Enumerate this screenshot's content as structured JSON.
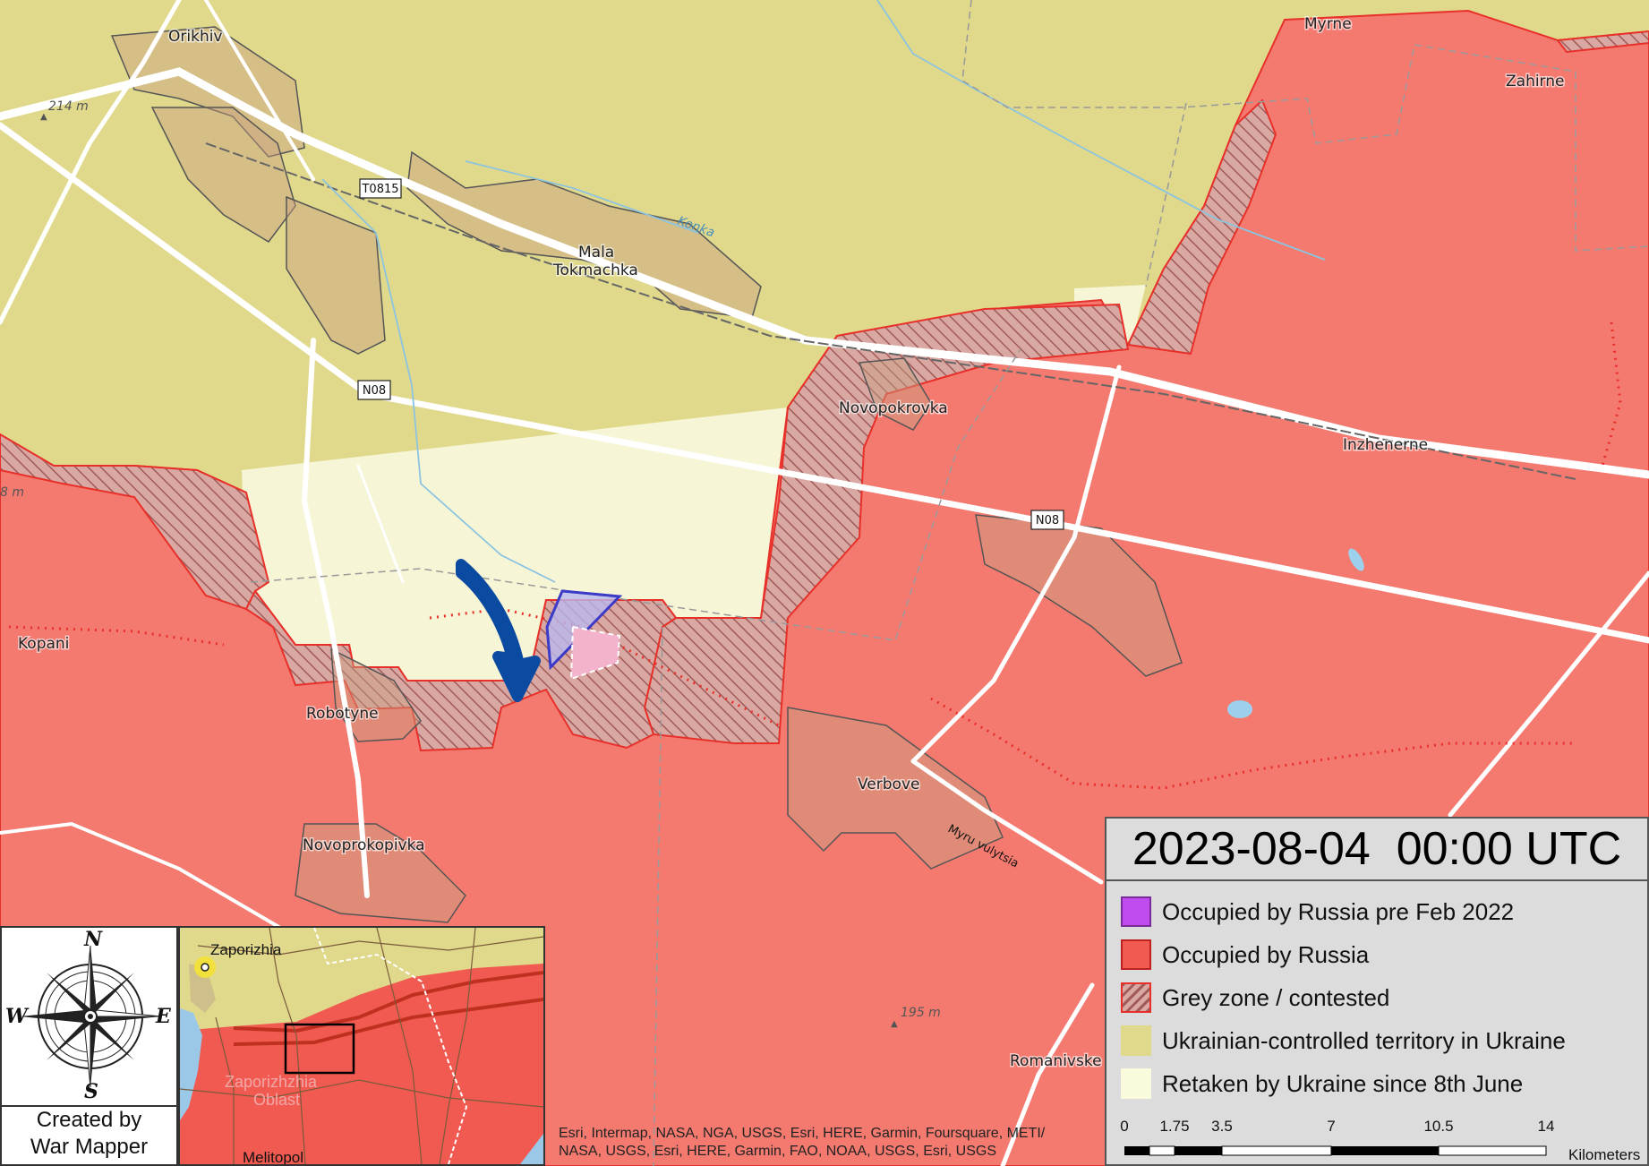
{
  "legend": {
    "date": "2023-08-04  00:00 UTC",
    "items": [
      {
        "label": "Occupied by Russia pre Feb 2022",
        "color": "#c04cf0",
        "style": "solid"
      },
      {
        "label": "Occupied by Russia",
        "color": "#f05a50",
        "style": "solid"
      },
      {
        "label": "Grey zone / contested",
        "color": "#c07a78",
        "style": "hatched"
      },
      {
        "label": "Ukrainian-controlled territory in Ukraine",
        "color": "#e0d98c",
        "style": "solid"
      },
      {
        "label": "Retaken by Ukraine since 8th June",
        "color": "#fafadc",
        "style": "solid"
      }
    ],
    "scale": {
      "ticks": [
        "0",
        "1.75",
        "3.5",
        "7",
        "10.5",
        "14"
      ],
      "unit": "Kilometers"
    }
  },
  "colors": {
    "occupied": "#f47a70",
    "ukrainian": "#e0d98c",
    "retaken": "#f6f5d6",
    "contested_base": "#d9a8a2",
    "contested_hatch": "#a05a58",
    "road": "#ffffff",
    "arrow": "#0a4aa0",
    "front_dots": "#e8302a"
  },
  "places": [
    {
      "name": "Orikhiv"
    },
    {
      "name": "Myrne"
    },
    {
      "name": "Zahirne"
    },
    {
      "name": "Mala"
    },
    {
      "name": "Tokmachka"
    },
    {
      "name": "Novopokrovka"
    },
    {
      "name": "Inzhenerne"
    },
    {
      "name": "Kopani"
    },
    {
      "name": "Robotyne"
    },
    {
      "name": "Verbove"
    },
    {
      "name": "Novoprokopivka"
    },
    {
      "name": "Romanivske"
    }
  ],
  "elevations": [
    "214 m",
    "195 m",
    "8 m"
  ],
  "water": [
    "Konka"
  ],
  "roads": [
    "T0815",
    "N08",
    "N08"
  ],
  "street": "Myru vulytsia",
  "compass": {
    "n": "N",
    "s": "S",
    "e": "E",
    "w": "W"
  },
  "credit": {
    "line1": "Created by",
    "line2": "War Mapper"
  },
  "inset": {
    "city": "Zaporizhia",
    "oblast_line1": "Zaporizhzhia",
    "oblast_line2": "Oblast",
    "south_city": "Melitopol"
  },
  "attribution": {
    "line1": "Esri, Intermap, NASA, NGA, USGS, Esri, HERE, Garmin, Foursquare, METI/",
    "line2": "NASA, USGS, Esri, HERE, Garmin, FAO, NOAA, USGS, Esri, USGS"
  }
}
